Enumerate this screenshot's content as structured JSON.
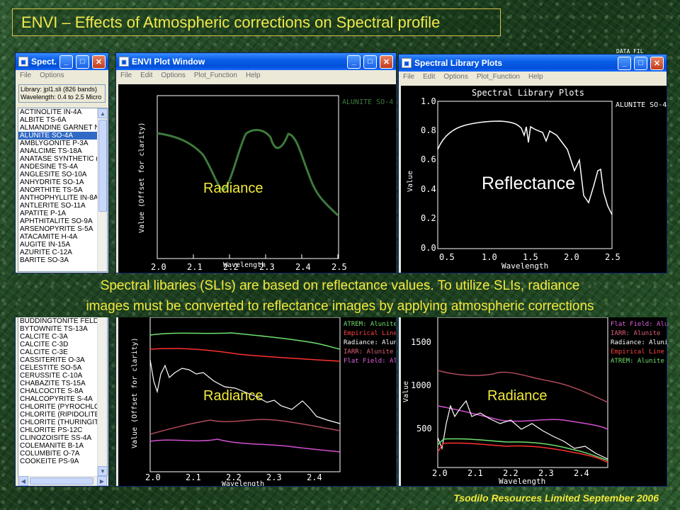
{
  "slide": {
    "title": "ENVI – Effects of Atmospheric corrections on Spectral profile",
    "caption_line1": "Spectral libaries (SLIs) are based on reflectance values. To utilize SLIs, radiance",
    "caption_line2": "images must be converted to reflectance images by applying atmospheric corrections",
    "footer": "Tsodilo Resources Limited September 2006",
    "top_right_fragment": "DATA FIL"
  },
  "library_window": {
    "title": "Spect...",
    "menu": [
      "File",
      "Options"
    ],
    "info_line1": "Library: jpl1.sli (826 bands)",
    "info_line2": "Wavelength: 0.4 to 2.5 Micro",
    "selected": "ALUNITE SO-4A",
    "items_top": [
      "ACTINOLITE IN-4A",
      "ALBITE TS-6A",
      "ALMANDINE GARNET N",
      "ALUNITE SO-4A",
      "AMBLYGONITE P-3A",
      "ANALCIME TS-18A",
      "ANATASE SYNTHETIC (",
      "ANDESINE TS-4A",
      "ANGLESITE SO-10A",
      "ANHYDRITE SO-1A",
      "ANORTHITE TS-5A",
      "ANTHOPHYLLITE IN-8A",
      "ANTLERITE SO-11A",
      "APATITE P-1A",
      "APHTHITALITE SO-9A",
      "ARSENOPYRITE S-5A",
      "ATACAMITE H-4A",
      "AUGITE IN-15A",
      "AZURITE C-12A",
      "BARITE SO-3A"
    ],
    "items_bottom": [
      "BUDDINGTONITE FELD",
      "BYTOWNITE TS-13A",
      "CALCITE C-3A",
      "CALCITE C-3D",
      "CALCITE C-3E",
      "CASSITERITE O-3A",
      "CELESTITE SO-5A",
      "CERUSSITE C-10A",
      "CHABAZITE TS-15A",
      "CHALCOCITE S-8A",
      "CHALCOPYRITE S-4A",
      "CHLORITE (PYROCHLO",
      "CHLORITE (RIPIDOLITE",
      "CHLORITE (THURINGIT",
      "CHLORITE PS-12C",
      "CLINOZOISITE SS-4A",
      "COLEMANITE B-1A",
      "COLUMBITE O-7A",
      "COOKEITE PS-9A"
    ]
  },
  "plot_window": {
    "title": "ENVI Plot Window",
    "menu": [
      "File",
      "Edit",
      "Options",
      "Plot_Function",
      "Help"
    ],
    "legend": "ALUNITE SO-4",
    "ylabel": "Value (Offset for clarity)",
    "xlabel": "Wavelength",
    "ticks": [
      "2.0",
      "2.1",
      "2.2",
      "2.3",
      "2.4",
      "2.5"
    ],
    "overlay": "Radiance",
    "color": "#3d7a3d"
  },
  "library_plot_window": {
    "title": "Spectral Library Plots",
    "menu": [
      "File",
      "Edit",
      "Options",
      "Plot_Function",
      "Help"
    ],
    "plot_title": "Spectral Library Plots",
    "legend": "ALUNITE SO-4",
    "ylabel": "Value",
    "xlabel": "Wavelength",
    "yticks": [
      "1.0",
      "0.8",
      "0.6",
      "0.4",
      "0.2",
      "0.0"
    ],
    "xticks": [
      "0.5",
      "1.0",
      "1.5",
      "2.0",
      "2.5"
    ],
    "overlay": "Reflectance"
  },
  "bottom_left_plot": {
    "legend": [
      {
        "text": "ATREM: Alunite",
        "color": "#6fe06f"
      },
      {
        "text": "Empirical Line",
        "color": "#ff4040"
      },
      {
        "text": "Radiance: Alunit",
        "color": "#ffffff"
      },
      {
        "text": "IARR: Alunite",
        "color": "#e0607a"
      },
      {
        "text": "Flat Field: Alu",
        "color": "#e060e0"
      }
    ],
    "ylabel": "Value (Offset for clarity)",
    "xlabel": "Wavelength",
    "ticks": [
      "2.0",
      "2.1",
      "2.2",
      "2.3",
      "2.4"
    ],
    "overlay": "Radiance"
  },
  "bottom_right_plot": {
    "legend": [
      {
        "text": "Flat Field: Alun",
        "color": "#e060e0"
      },
      {
        "text": "IARR: Alunite",
        "color": "#e0607a"
      },
      {
        "text": "Radiance: Alunit",
        "color": "#ffffff"
      },
      {
        "text": "Empirical Line",
        "color": "#ff4040"
      },
      {
        "text": "ATREM: Alunite",
        "color": "#6fe06f"
      }
    ],
    "ylabel": "Value",
    "xlabel": "Wavelength",
    "yticks": [
      "1500",
      "1000",
      "500"
    ],
    "xticks": [
      "2.0",
      "2.1",
      "2.2",
      "2.3",
      "2.4"
    ],
    "overlay": "Radiance"
  }
}
